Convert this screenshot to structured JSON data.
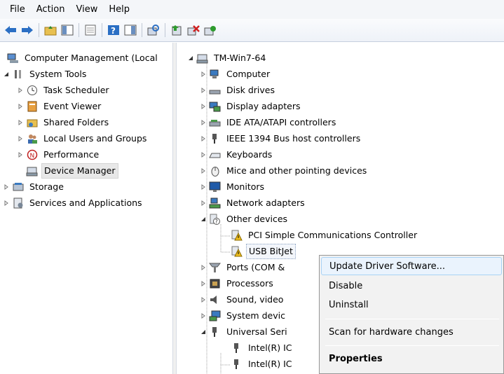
{
  "menubar": {
    "items": [
      "File",
      "Action",
      "View",
      "Help"
    ]
  },
  "left_tree": {
    "root": "Computer Management (Local",
    "system_tools": "System Tools",
    "task_scheduler": "Task Scheduler",
    "event_viewer": "Event Viewer",
    "shared_folders": "Shared Folders",
    "local_users": "Local Users and Groups",
    "performance": "Performance",
    "device_manager": "Device Manager",
    "storage": "Storage",
    "services": "Services and Applications"
  },
  "device_tree": {
    "root": "TM-Win7-64",
    "computer": "Computer",
    "disk_drives": "Disk drives",
    "display_adapters": "Display adapters",
    "ide": "IDE ATA/ATAPI controllers",
    "ieee1394": "IEEE 1394 Bus host controllers",
    "keyboards": "Keyboards",
    "mice": "Mice and other pointing devices",
    "monitors": "Monitors",
    "network": "Network adapters",
    "other_devices": "Other devices",
    "pci_simple": "PCI Simple Communications Controller",
    "usb_bitjet": "USB BitJet",
    "ports": "Ports (COM &",
    "processors": "Processors",
    "sound": "Sound, video",
    "system_devices": "System devic",
    "universal_serial": "Universal Seri",
    "intel_1": "Intel(R) IC",
    "intel_2": "Intel(R) IC"
  },
  "context_menu": {
    "update_driver": "Update Driver Software...",
    "disable": "Disable",
    "uninstall": "Uninstall",
    "scan": "Scan for hardware changes",
    "properties": "Properties"
  },
  "colors": {
    "warning": "#f0c020",
    "toolbar_blue": "#2b6fc4",
    "hover_border": "#a8d2f5"
  }
}
